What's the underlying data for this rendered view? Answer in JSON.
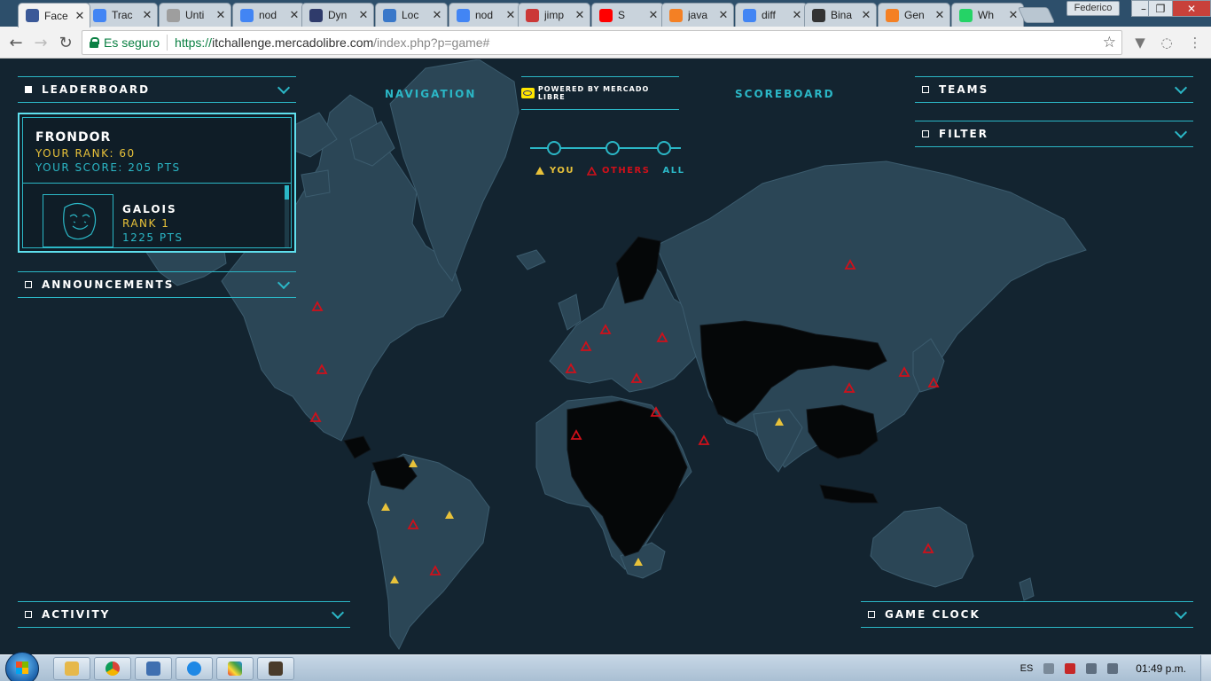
{
  "browser": {
    "tabs": [
      {
        "title": "Face",
        "icon": "globe-icon",
        "color": "#3b5998",
        "active": true
      },
      {
        "title": "Trac",
        "icon": "google-translate-icon",
        "color": "#4285f4"
      },
      {
        "title": "Unti",
        "icon": "page-icon",
        "color": "#9e9e9e"
      },
      {
        "title": "nod",
        "icon": "google-icon",
        "color": "#4285f4"
      },
      {
        "title": "Dyn",
        "icon": "hackernoon-icon",
        "color": "#2f3b6b"
      },
      {
        "title": "Loc",
        "icon": "page-icon",
        "color": "#3a78c9"
      },
      {
        "title": "nod",
        "icon": "google-icon",
        "color": "#4285f4"
      },
      {
        "title": "jimp",
        "icon": "npm-icon",
        "color": "#cb3837"
      },
      {
        "title": "S",
        "icon": "youtube-icon",
        "color": "#ff0000"
      },
      {
        "title": "java",
        "icon": "stackoverflow-icon",
        "color": "#f48024"
      },
      {
        "title": "diff",
        "icon": "google-icon",
        "color": "#4285f4"
      },
      {
        "title": "Bina",
        "icon": "tutorials-icon",
        "color": "#333333"
      },
      {
        "title": "Gen",
        "icon": "stackoverflow-icon",
        "color": "#f48024"
      },
      {
        "title": "Wh",
        "icon": "whatsapp-icon",
        "color": "#25d366"
      }
    ],
    "tab_close_glyph": "✕",
    "profile": "Federico",
    "secure_label": "Es seguro",
    "url_scheme": "https://",
    "url_host": "itchallenge.mercadolibre.com",
    "url_path": "/index.php?p=game#"
  },
  "game": {
    "leaderboard": {
      "title": "LEADERBOARD",
      "team": "FRONDOR",
      "rank_line": "YOUR RANK: 60",
      "score_line": "YOUR SCORE: 205  PTS",
      "leader_name": "GALOIS",
      "leader_rank": "RANK 1",
      "leader_pts": "1225 PTS"
    },
    "announcements": "ANNOUNCEMENTS",
    "activity": "ACTIVITY",
    "teams": "TEAMS",
    "filter": "FILTER",
    "game_clock": "GAME CLOCK",
    "nav": {
      "navigation": "NAVIGATION",
      "scoreboard": "SCOREBOARD"
    },
    "powered_by": "POWERED BY MERCADO LIBRE",
    "legend": {
      "you": "YOU",
      "others": "OTHERS",
      "all": "ALL"
    },
    "colors": {
      "accent": "#2bb7c6",
      "you": "#e8c23a",
      "others": "#d0101a",
      "land": "#2b4656",
      "dark_land": "#050708"
    }
  },
  "taskbar": {
    "language": "ES",
    "clock": "01:49 p.m."
  }
}
